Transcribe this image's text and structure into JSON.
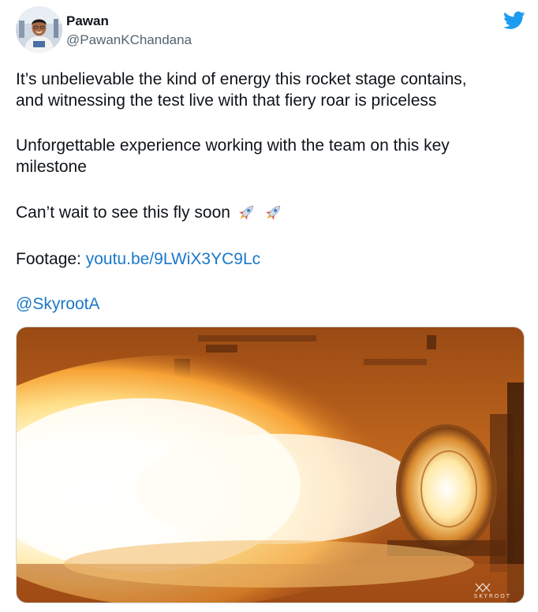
{
  "author": {
    "name": "Pawan",
    "handle": "@PawanKChandana"
  },
  "icons": {
    "brand": "twitter-bird-icon",
    "emoji": "rocket-emoji-icon"
  },
  "colors": {
    "link": "#1b78c8",
    "brand": "#1d9bf0",
    "text": "#0f1419",
    "secondary": "#536471"
  },
  "tweet": {
    "paragraph1_line1": "It’s unbelievable the kind of energy this rocket stage contains,",
    "paragraph1_line2": "and witnessing the test live with that fiery roar is priceless",
    "paragraph2_line1": "Unforgettable experience working with the team on this key",
    "paragraph2_line2": "milestone",
    "paragraph3": "Can’t wait to see this fly soon",
    "footage_label": "Footage: ",
    "footage_link": "youtu.be/9LWiX3YC9Lc",
    "mention": "@SkyrootA"
  },
  "media": {
    "watermark": "SKYROOT"
  }
}
